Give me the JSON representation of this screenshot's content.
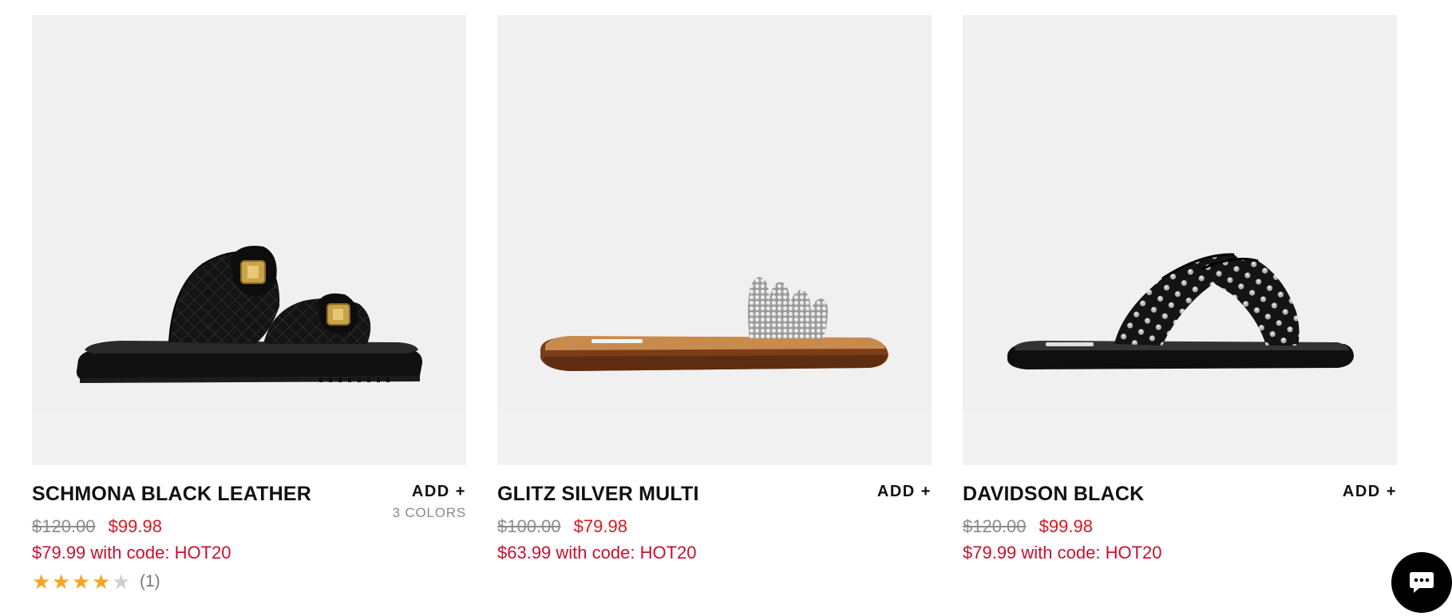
{
  "products": [
    {
      "name": "SCHMONA BLACK LEATHER",
      "add_label": "ADD +",
      "colors_label": "3 COLORS",
      "original_price": "$120.00",
      "sale_price": "$99.98",
      "promo_text": "$79.99 with code: HOT20",
      "rating": 4,
      "rating_max": 5,
      "review_count": "(1)",
      "image_icon": "black-quilted-slide-sandal-image"
    },
    {
      "name": "GLITZ SILVER MULTI",
      "add_label": "ADD +",
      "original_price": "$100.00",
      "sale_price": "$79.98",
      "promo_text": "$63.99 with code: HOT20",
      "image_icon": "rhinestone-slide-sandal-image"
    },
    {
      "name": "DAVIDSON BLACK",
      "add_label": "ADD +",
      "original_price": "$120.00",
      "sale_price": "$99.98",
      "promo_text": "$79.99 with code: HOT20",
      "image_icon": "studded-crisscross-sandal-image"
    }
  ],
  "chat": {
    "icon": "chat-bubble-icon"
  },
  "colors": {
    "sale_red": "#d71920",
    "promo_red": "#c8102e",
    "star_gold": "#f5a623",
    "image_bg": "#f0f0f0"
  }
}
